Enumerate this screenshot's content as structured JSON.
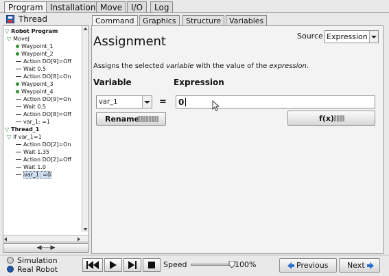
{
  "top_tabs": [
    {
      "label": "Program"
    },
    {
      "label": "Installation"
    },
    {
      "label": "Move"
    },
    {
      "label": "I/O"
    },
    {
      "label": "Log"
    }
  ],
  "panel_title": "Thread",
  "tree": [
    {
      "label": "Robot Program",
      "kind": "root"
    },
    {
      "label": "MoveJ",
      "kind": "move"
    },
    {
      "label": "Waypoint_1",
      "kind": "waypoint"
    },
    {
      "label": "Waypoint_2",
      "kind": "waypoint"
    },
    {
      "label": "Action DO[9]=Off",
      "kind": "line"
    },
    {
      "label": "Wait 0.5",
      "kind": "line"
    },
    {
      "label": "Action DO[8]=On",
      "kind": "line"
    },
    {
      "label": "Waypoint_3",
      "kind": "waypoint"
    },
    {
      "label": "Waypoint_4",
      "kind": "waypoint"
    },
    {
      "label": "Action DO[9]=On",
      "kind": "line"
    },
    {
      "label": "Wait 0.5",
      "kind": "line"
    },
    {
      "label": "Action DO[8]=Off",
      "kind": "line"
    },
    {
      "label": "var_1: =1",
      "kind": "line"
    },
    {
      "label": "Thread_1",
      "kind": "root"
    },
    {
      "label": "If var_1=1",
      "kind": "move"
    },
    {
      "label": "Action DO[2]=On",
      "kind": "line"
    },
    {
      "label": "Wait 1.35",
      "kind": "line"
    },
    {
      "label": "Action DO[2]=Off",
      "kind": "line"
    },
    {
      "label": "Wait 1.0",
      "kind": "line"
    },
    {
      "label": "var_1: =0",
      "kind": "line",
      "selected": true
    }
  ],
  "tree_nav_arrow": "◀----▶",
  "sub_tabs": [
    {
      "label": "Command"
    },
    {
      "label": "Graphics"
    },
    {
      "label": "Structure"
    },
    {
      "label": "Variables"
    }
  ],
  "assignment": {
    "title": "Assignment",
    "source_label": "Source",
    "source_value": "Expression",
    "description_pre": "Assigns the selected ",
    "description_var": "variable",
    "description_mid": " with the value of the ",
    "description_expr": "expression",
    "description_end": ".",
    "variable_header": "Variable",
    "expression_header": "Expression",
    "variable_value": "var_1",
    "equals": "=",
    "expression_value": "0",
    "rename_label": "Rename",
    "fx_label": "f(x)"
  },
  "mode": {
    "simulation_label": "Simulation",
    "real_robot_label": "Real Robot",
    "selected": "real"
  },
  "speed": {
    "label": "Speed",
    "value_text": "100%",
    "fraction": 1.0
  },
  "nav": {
    "previous_label": "Previous",
    "next_label": "Next"
  },
  "colors": {
    "accent_blue": "#2a6fc9",
    "tab_active": "#f4f4f4",
    "panel_bg": "#e9e9e9"
  }
}
